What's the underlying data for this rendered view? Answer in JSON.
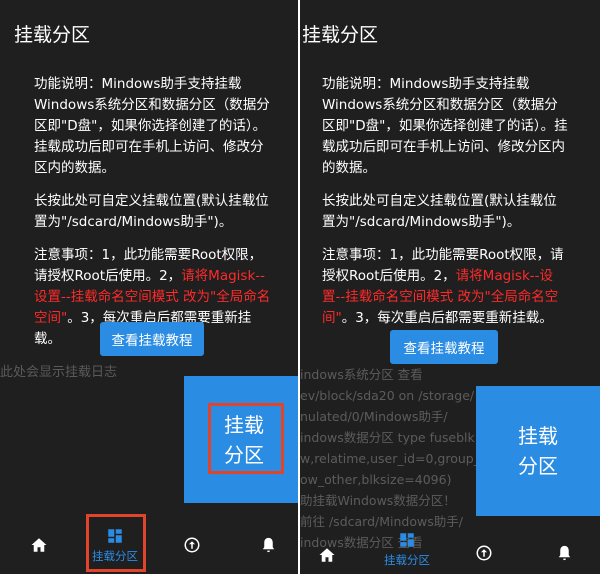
{
  "title": "挂载分区",
  "description": {
    "intro": "功能说明：Mindows助手支持挂载Windows系统分区和数据分区（数据分区即\"D盘\"，如果你选择创建了的话）。挂载成功后即可在手机上访问、修改分区内的数据。",
    "long_press": "长按此处可自定义挂载位置(默认挂载位置为\"/sdcard/Mindows助手\")。",
    "notes_before": "注意事项：1，此功能需要Root权限，请授权Root后使用。2，",
    "notes_red": "请将Magisk--设置--挂载命名空间模式 改为\"全局命名空间\"",
    "notes_after": "。3，每次重启后都需要重新挂载。"
  },
  "tutorial_button": "查看挂载教程",
  "mount_button": {
    "line1": "挂载",
    "line2": "分区"
  },
  "log_placeholder": "此处会显示挂载日志",
  "log_lines": [
    "indows系统分区 查看",
    "ev/block/sda20 on /storage/",
    "nulated/0/Mindows助手/",
    "indows数据分区 type fuseblk",
    "w,relatime,user_id=0,group_id=0,",
    "ow_other,blksize=4096)",
    "助挂载Windows数据分区！",
    "前往 /sdcard/Mindows助手/",
    "indows数据分区 查看"
  ],
  "nav": {
    "home_icon": "home-icon",
    "mount_icon": "dashboard-grid-icon",
    "mount_label": "挂载分区",
    "upload_icon": "circle-up-arrow-icon",
    "bell_icon": "bell-icon",
    "active_color": "#2b8ce4"
  },
  "colors": {
    "background": "#1f1f1f",
    "accent": "#2b8ce4",
    "warning": "#ff2a2a",
    "highlight": "#e0442b"
  }
}
